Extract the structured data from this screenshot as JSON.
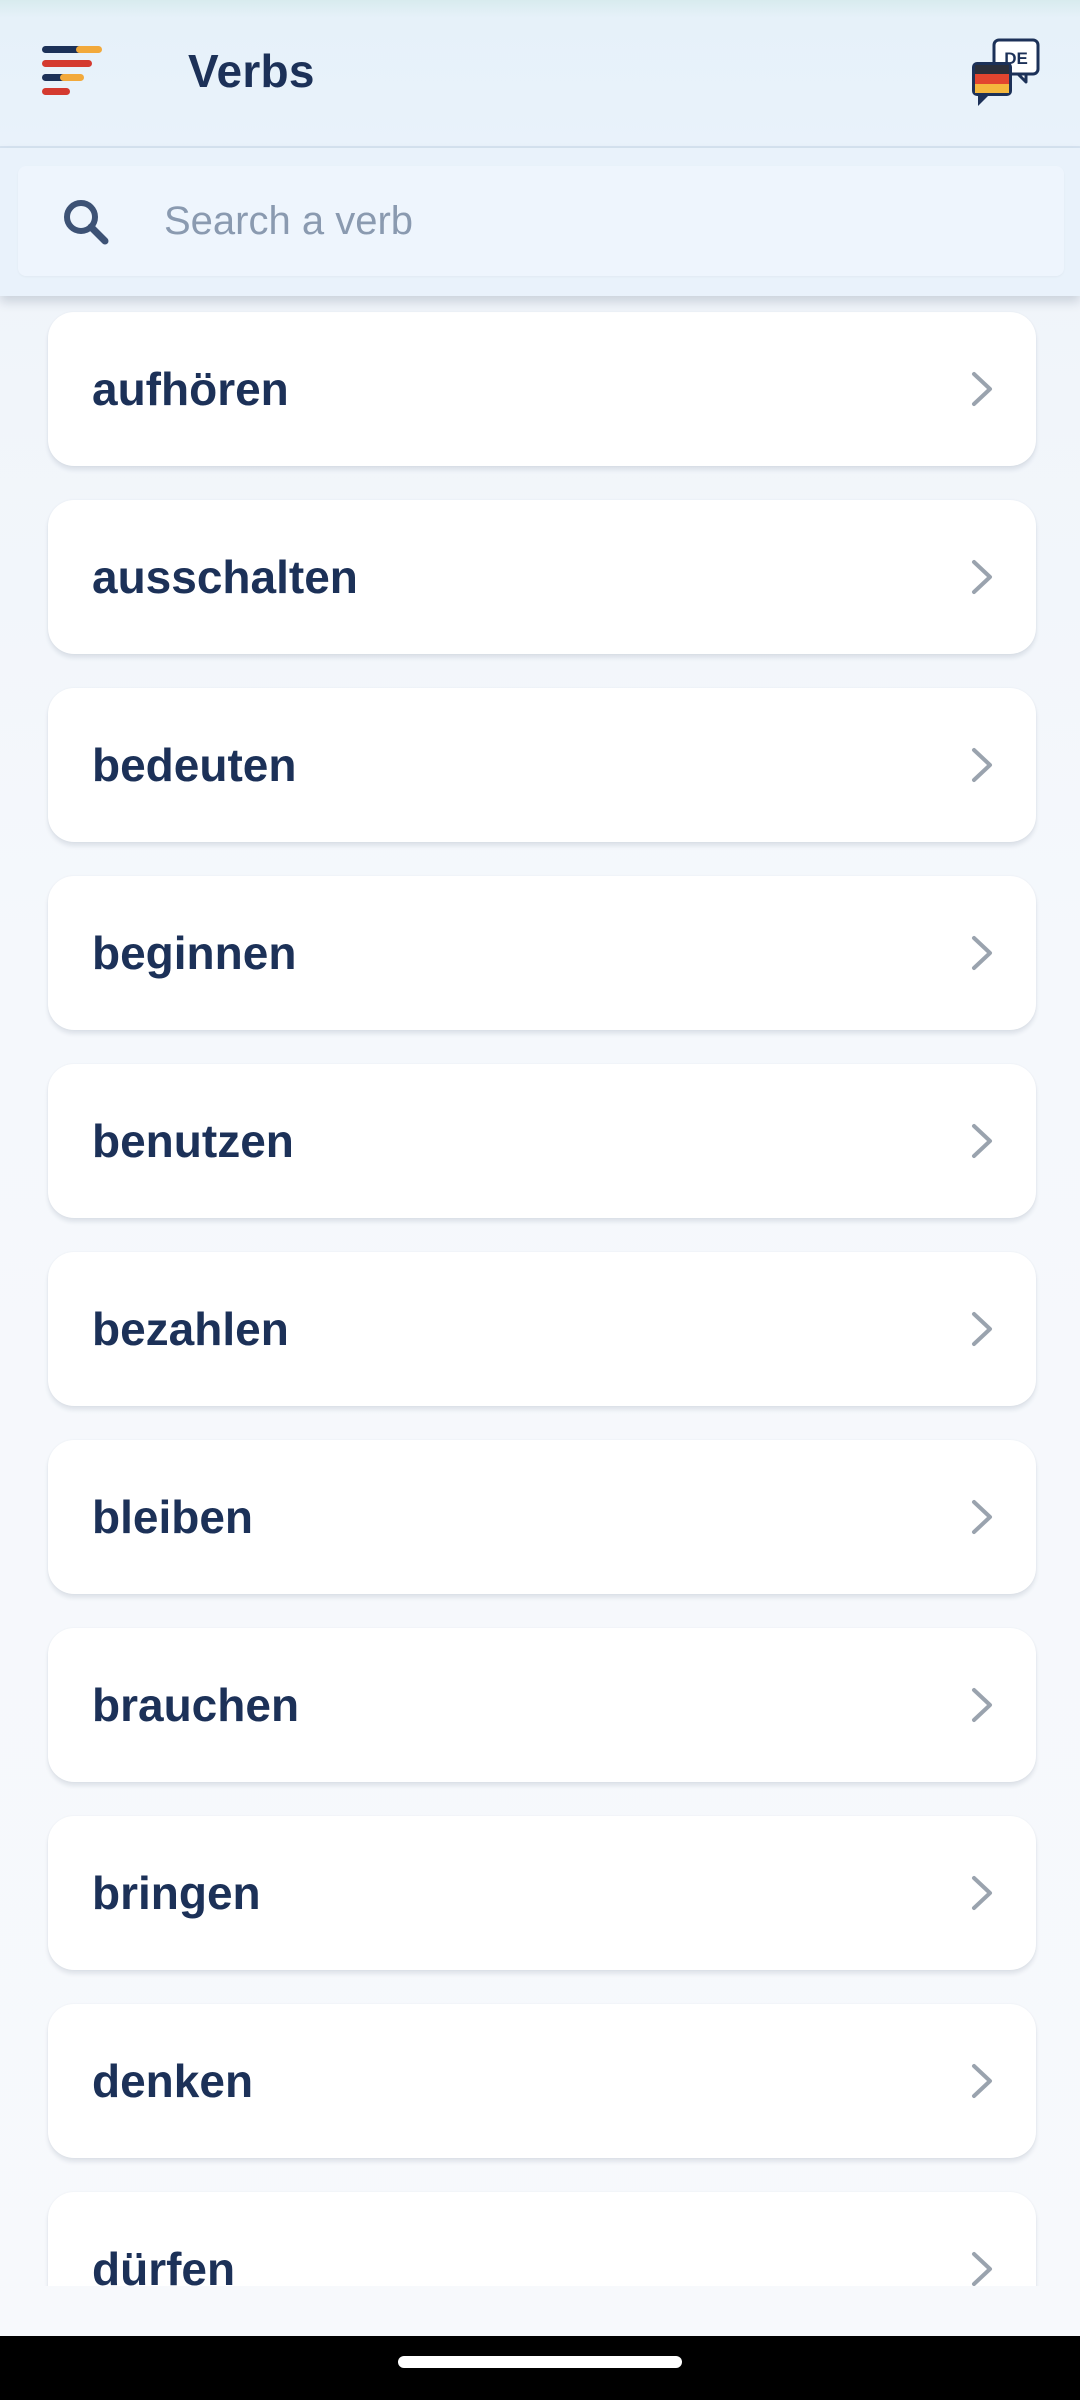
{
  "header": {
    "title": "Verbs",
    "menu_icon": "hamburger-menu-icon",
    "language_icon": "language-flag-chat-icon",
    "language_badge": "DE"
  },
  "search": {
    "placeholder": "Search a verb",
    "value": "",
    "icon": "search-icon"
  },
  "verbs": [
    {
      "label": "aufhören"
    },
    {
      "label": "ausschalten"
    },
    {
      "label": "bedeuten"
    },
    {
      "label": "beginnen"
    },
    {
      "label": "benutzen"
    },
    {
      "label": "bezahlen"
    },
    {
      "label": "bleiben"
    },
    {
      "label": "brauchen"
    },
    {
      "label": "bringen"
    },
    {
      "label": "denken"
    },
    {
      "label": "dürfen"
    }
  ],
  "colors": {
    "text_primary": "#1c3158",
    "chevron": "#9aa3ae",
    "menu_red": "#d43a2f",
    "menu_orange": "#f2a93b",
    "menu_navy": "#1c3158"
  }
}
